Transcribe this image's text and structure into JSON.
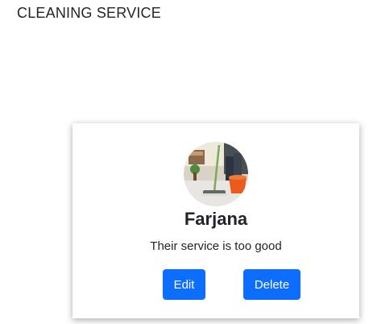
{
  "header": {
    "title": "CLEANING SERVICE"
  },
  "review": {
    "avatar_icon": "cleaning-photo-avatar",
    "name": "Farjana",
    "text": "Their service is too good",
    "edit_label": "Edit",
    "delete_label": "Delete"
  },
  "colors": {
    "button": "#0d6efd",
    "text": "#212529"
  }
}
